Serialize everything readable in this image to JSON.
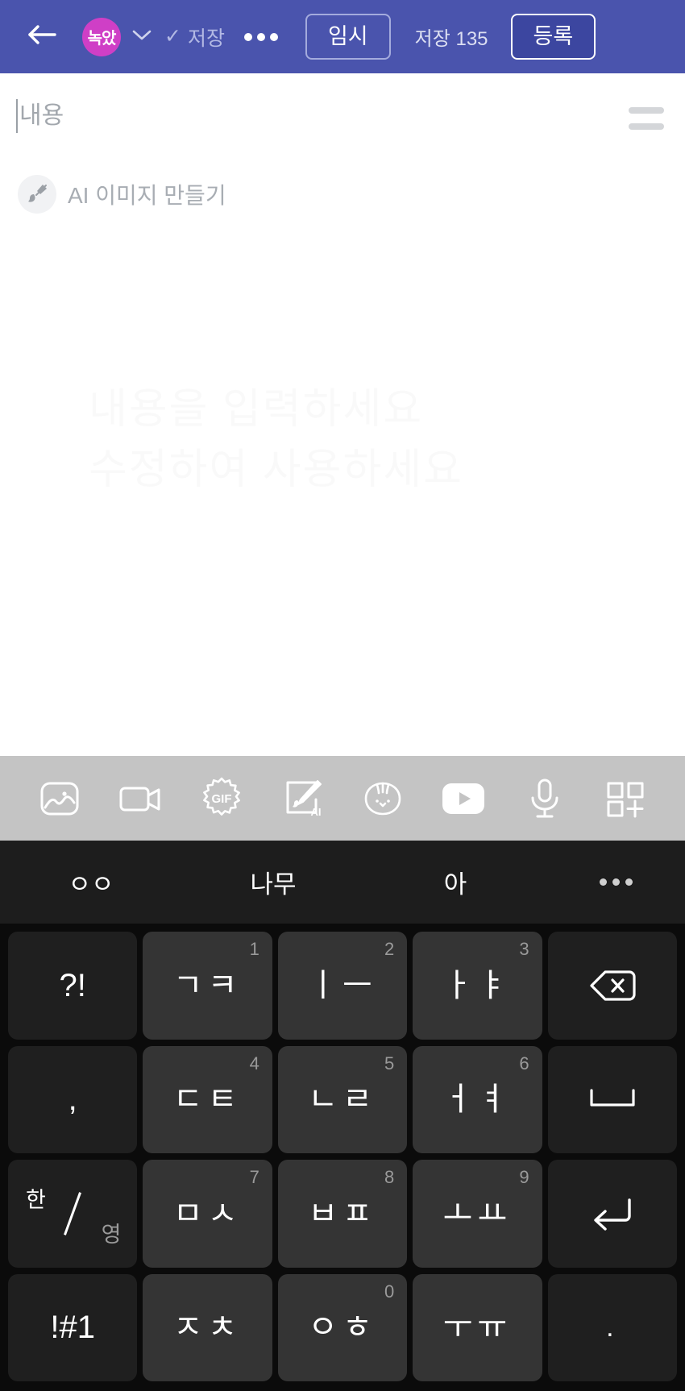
{
  "header": {
    "back_icon": "back-arrow-icon",
    "avatar_label": "녹았",
    "avatar_color": "#cf3fc6",
    "chevron_icon": "chevron-down-icon",
    "saved_check": "✓",
    "saved_label": "저장",
    "more_icon": "more-dots-icon",
    "temp_label": "임시",
    "count_label": "저장 135",
    "submit_label": "등록",
    "bar_color": "#4a54ad"
  },
  "editor": {
    "body_placeholder": "내용",
    "menu_icon": "hamburger-lines-icon",
    "ai_icon": "paint-brush-icon",
    "ai_label": "AI 이미지 만들기",
    "watermark_text": "내용을 입력하세요\n수정하여 사용하세요"
  },
  "attach_toolbar": {
    "background": "#c4c4c4",
    "items": [
      {
        "name": "image-icon",
        "label": "사진"
      },
      {
        "name": "video-icon",
        "label": "동영상"
      },
      {
        "name": "gif-icon",
        "label": "GIF"
      },
      {
        "name": "ai-draw-icon",
        "label": "AI"
      },
      {
        "name": "sticker-icon",
        "label": "스티커"
      },
      {
        "name": "youtube-icon",
        "label": "유튜브"
      },
      {
        "name": "microphone-icon",
        "label": "음성"
      },
      {
        "name": "more-grid-icon",
        "label": "더보기"
      }
    ]
  },
  "suggestions": {
    "items": [
      "ㅇㅇ",
      "나무",
      "아"
    ],
    "more_icon": "more-dots-icon"
  },
  "keyboard": {
    "rows": [
      [
        {
          "main": "?!",
          "num": "",
          "type": "fn"
        },
        {
          "main": "ㄱㅋ",
          "num": "1",
          "type": "char"
        },
        {
          "main": "ㅣㅡ",
          "num": "2",
          "type": "char"
        },
        {
          "main": "ㅏㅑ",
          "num": "3",
          "type": "char"
        },
        {
          "main": "",
          "num": "",
          "type": "backspace",
          "icon": "backspace-icon"
        }
      ],
      [
        {
          "main": ",",
          "num": "",
          "type": "fn"
        },
        {
          "main": "ㄷㅌ",
          "num": "4",
          "type": "char"
        },
        {
          "main": "ㄴㄹ",
          "num": "5",
          "type": "char"
        },
        {
          "main": "ㅓㅕ",
          "num": "6",
          "type": "char"
        },
        {
          "main": "",
          "num": "",
          "type": "space",
          "icon": "spacebar-icon"
        }
      ],
      [
        {
          "main": "한/영",
          "num": "",
          "type": "lang",
          "han": "한",
          "eng": "영"
        },
        {
          "main": "ㅁㅅ",
          "num": "7",
          "type": "char"
        },
        {
          "main": "ㅂㅍ",
          "num": "8",
          "type": "char"
        },
        {
          "main": "ㅗㅛ",
          "num": "9",
          "type": "char"
        },
        {
          "main": "",
          "num": "",
          "type": "enter",
          "icon": "enter-icon"
        }
      ],
      [
        {
          "main": "!#1",
          "num": "",
          "type": "fn"
        },
        {
          "main": "ㅈㅊ",
          "num": "",
          "type": "char"
        },
        {
          "main": "ㅇㅎ",
          "num": "0",
          "type": "char"
        },
        {
          "main": "ㅜㅠ",
          "num": "",
          "type": "char"
        },
        {
          "main": ".",
          "num": "",
          "type": "fn"
        }
      ]
    ]
  }
}
